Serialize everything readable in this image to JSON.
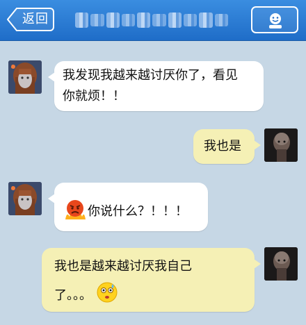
{
  "header": {
    "back_label": "返回",
    "back_icon": "chevron-left-icon",
    "profile_icon": "smiley-user-icon",
    "accent_color": "#2a7cd6"
  },
  "messages": [
    {
      "side": "left",
      "avatar": "girl-avatar",
      "line1": "我发现我越来越讨厌你了，看见",
      "line2": "你就烦！！"
    },
    {
      "side": "right",
      "avatar": "man-avatar",
      "line1": "我也是"
    },
    {
      "side": "left",
      "avatar": "girl-avatar",
      "emoji": "angry-face-icon",
      "line1": "你说什么？！！！"
    },
    {
      "side": "right",
      "avatar": "man-avatar",
      "line1": "我也是越来越讨厌我自己",
      "line2": "了。。。",
      "emoji": "worried-face-icon"
    }
  ]
}
